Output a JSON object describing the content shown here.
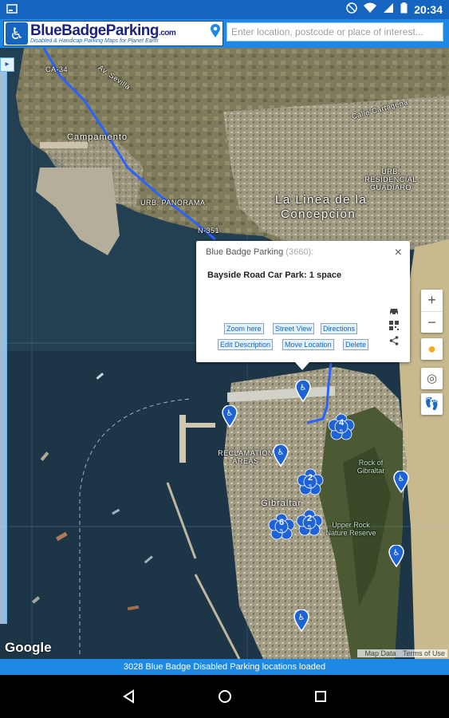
{
  "status_bar": {
    "time": "20:34",
    "icons": [
      "screenshot-icon",
      "dnd-icon",
      "wifi-icon",
      "signal-icon",
      "battery-icon"
    ]
  },
  "header": {
    "logo_title": "BlueBadgeParking",
    "logo_title_suffix": ".com",
    "logo_subtitle": "Disabled & Handicap Parking Maps for Planet Earth",
    "search_placeholder": "Enter location, postcode or place of interest..."
  },
  "map": {
    "labels": {
      "campamento": "Campamento",
      "la_linea": "La Linea de la",
      "concepcion": "Concepción",
      "urb_panorama": "URB. PANORAMA",
      "residencial": "URB. RESIDENCIAL GUADIARO",
      "reclamation": "RECLAMATION AREAS",
      "gibraltar": "Gibraltar",
      "rock": "Rock of Gibraltar",
      "upper_rock": "Upper Rock Nature Reserve",
      "calle_cartagena": "Calle Cartagena",
      "road_ca34": "CA-34",
      "road_n351": "N-351",
      "av_sevilla": "Av. Sevilla"
    },
    "google": "Google",
    "attribution": {
      "data": "Map Data",
      "terms": "Terms of Use"
    },
    "clusters": [
      {
        "count": "4",
        "sub": "5"
      },
      {
        "count": "2",
        "sub": "5"
      },
      {
        "count": "6",
        "sub": "5"
      },
      {
        "count": "2",
        "sub": "5"
      }
    ]
  },
  "popup": {
    "title": "Blue Badge Parking",
    "count": "(3660):",
    "location": "Bayside Road Car Park: 1 space",
    "buttons": {
      "zoom_here": "Zoom here",
      "street_view": "Street View",
      "directions": "Directions",
      "edit_description": "Edit Description",
      "move_location": "Move Location",
      "delete": "Delete"
    },
    "close": "×"
  },
  "controls": {
    "zoom_in": "+",
    "zoom_out": "−"
  },
  "footer": {
    "status": "3028 Blue Badge Disabled Parking locations loaded"
  },
  "colors": {
    "brand_blue": "#1e88e5",
    "status_blue": "#1565c0",
    "marker_blue": "#1e63d6",
    "route_blue": "#2962ff"
  }
}
